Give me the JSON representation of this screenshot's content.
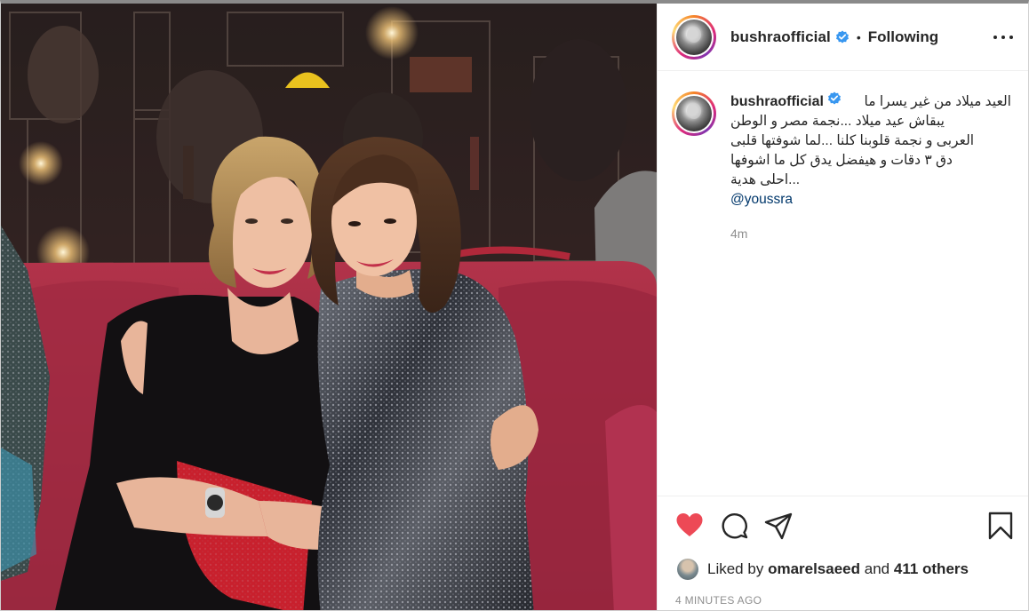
{
  "post": {
    "username": "bushraofficial",
    "verified": true,
    "follow_status": "Following",
    "more_icon": "more-horizontal-icon"
  },
  "caption": {
    "username": "bushraofficial",
    "lines": [
      "العيد ميلاد من غير يسرا ما",
      "يبقاش عيد ميلاد ...نجمة مصر و الوطن",
      "العربى و نجمة قلوبنا كلنا ...لما شوفتها قلبى",
      "دق ٣ دقات و هيفضل يدق كل ما اشوفها",
      "...احلى هدية"
    ],
    "mention": "@youssra",
    "time": "4m"
  },
  "actions": {
    "like_icon": "heart-filled-icon",
    "like_color": "#ed4956",
    "comment_icon": "comment-icon",
    "share_icon": "share-icon",
    "save_icon": "bookmark-icon"
  },
  "likes": {
    "prefix": "Liked by",
    "first_user": "omarelsaeed",
    "connector": "and",
    "others": "411 others"
  },
  "timestamp": "4 MINUTES AGO"
}
